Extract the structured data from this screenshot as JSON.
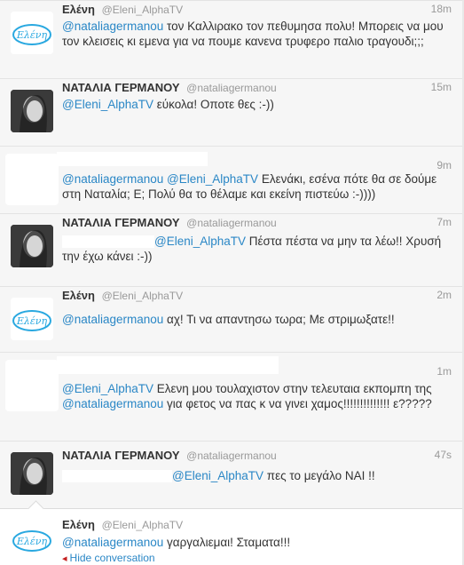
{
  "tweets": [
    {
      "name": "Ελένη",
      "handle": "@Eleni_AlphaTV",
      "time": "18m",
      "avatar": "eleni-logo",
      "mention1": "@nataliagermanou",
      "text1": " τον Καλλιρακο τον πεθυμησα πολυ! Μπορεις να μου τον κλεισεις κι εμενα για να πουμε κανενα τρυφερο παλιο τραγουδι;;;"
    },
    {
      "name": "ΝΑΤΑΛΙΑ ΓΕΡΜΑΝΟΥ",
      "handle": "@nataliagermanou",
      "time": "15m",
      "avatar": "natalia-photo",
      "mention1": "@Eleni_AlphaTV",
      "text1": " εύκολα! Οποτε θες :-))"
    },
    {
      "name": "",
      "handle": "",
      "time": "9m",
      "avatar": "blank",
      "mention1": "@nataliagermanou",
      "mention2": "@Eleni_AlphaTV",
      "text1": " Ελενάκι, εσένα πότε θα σε δούμε στη Ναταλία; Ε; Πολύ θα το θέλαμε και εκείνη πιστεύω :-))))"
    },
    {
      "name": "ΝΑΤΑΛΙΑ ΓΕΡΜΑΝΟΥ",
      "handle": "@nataliagermanou",
      "time": "7m",
      "avatar": "natalia-photo",
      "mention1": "@Eleni_AlphaTV",
      "text1": " Πέστα πέστα να μην τα λέω!! Χρυσή την έχω κάνει :-))"
    },
    {
      "name": "Ελένη",
      "handle": "@Eleni_AlphaTV",
      "time": "2m",
      "avatar": "eleni-logo",
      "mention1": "@nataliagermanou",
      "text1": " αχ! Τι να απαντησω τωρα; Με στριμωξατε!!"
    },
    {
      "name": "",
      "handle": "",
      "time": "1m",
      "avatar": "blank",
      "mention1": "@Eleni_AlphaTV",
      "text1": " Ελενη μου τουλαχιστον στην τελευταια εκπομπη της ",
      "mention2": "@nataliagermanou",
      "text2": " για φετος να πας κ να γινει χαμος!!!!!!!!!!!!!! ε?????"
    },
    {
      "name": "ΝΑΤΑΛΙΑ ΓΕΡΜΑΝΟΥ",
      "handle": "@nataliagermanou",
      "time": "47s",
      "avatar": "natalia-photo",
      "mention1": "@Eleni_AlphaTV",
      "text1": " πες το μεγάλο ΝΑΙ !!"
    },
    {
      "name": "Ελένη",
      "handle": "@Eleni_AlphaTV",
      "time": "",
      "avatar": "eleni-logo",
      "mention1": "@nataliagermanou",
      "text1": " γαργαλιεμαι! Σταματα!!!",
      "hide_label": "Hide conversation"
    }
  ],
  "logo_text": "Ελένη",
  "colors": {
    "mention": "#2a87c6",
    "logo": "#29a8e0",
    "hide_arrow": "#c41e1e"
  }
}
